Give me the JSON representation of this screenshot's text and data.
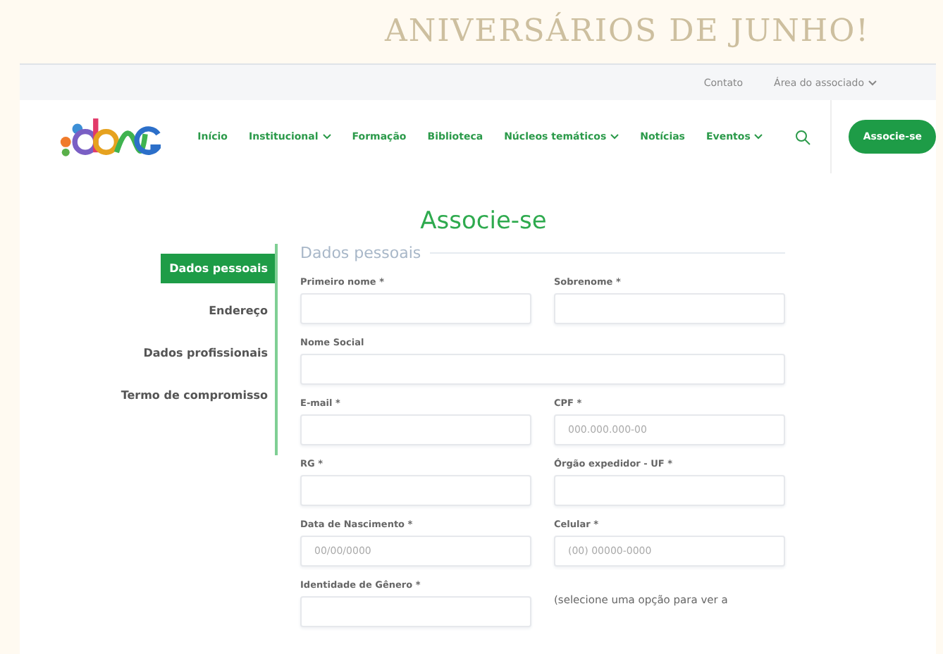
{
  "banner": {
    "title": "ANIVERSÁRIOS DE JUNHO!"
  },
  "top_links": [
    {
      "label": "Contato",
      "dropdown": false
    },
    {
      "label": "Área do associado",
      "dropdown": true
    }
  ],
  "nav": [
    {
      "label": "Início",
      "dropdown": false
    },
    {
      "label": "Institucional",
      "dropdown": true
    },
    {
      "label": "Formação",
      "dropdown": false
    },
    {
      "label": "Biblioteca",
      "dropdown": false
    },
    {
      "label": "Núcleos temáticos",
      "dropdown": true
    },
    {
      "label": "Notícias",
      "dropdown": false
    },
    {
      "label": "Eventos",
      "dropdown": true
    }
  ],
  "cta": "Associe-se",
  "page_title": "Associe-se",
  "steps": [
    {
      "label": "Dados pessoais",
      "selected": true
    },
    {
      "label": "Endereço",
      "selected": false
    },
    {
      "label": "Dados profissionais",
      "selected": false
    },
    {
      "label": "Termo de compromisso",
      "selected": false
    }
  ],
  "section_title": "Dados pessoais",
  "fields": [
    {
      "label": "Primeiro nome *",
      "kind": "half"
    },
    {
      "label": "Sobrenome *",
      "kind": "half"
    },
    {
      "label": "Nome Social",
      "kind": "full"
    },
    {
      "label": "E-mail *",
      "kind": "half"
    },
    {
      "label": "CPF *",
      "kind": "half",
      "placeholder": "000.000.000-00"
    },
    {
      "label": "RG *",
      "kind": "half"
    },
    {
      "label": "Órgão expedidor - UF *",
      "kind": "half"
    },
    {
      "label": "Data de Nascimento *",
      "kind": "half",
      "placeholder": "00/00/0000"
    },
    {
      "label": "Celular *",
      "kind": "half",
      "placeholder": "(00) 00000-0000"
    },
    {
      "label": "Identidade de Gênero *",
      "kind": "half"
    },
    {
      "text": "(selecione uma opção para ver a",
      "kind": "note"
    }
  ]
}
